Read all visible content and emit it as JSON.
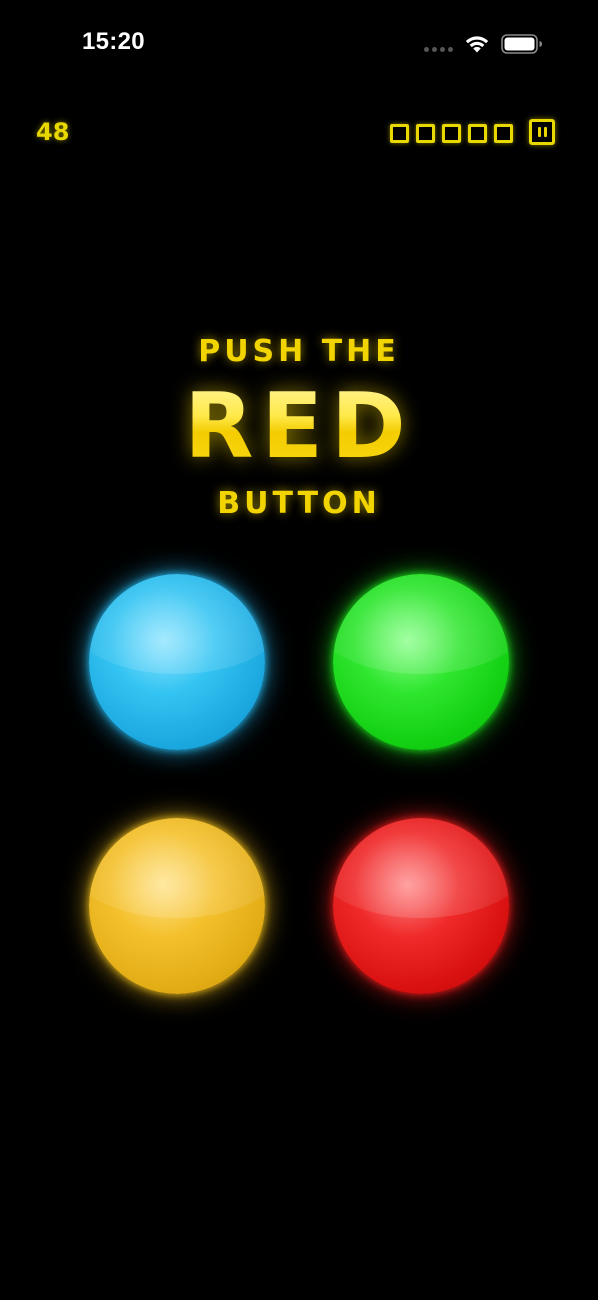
{
  "status_bar": {
    "time": "15:20",
    "icons": [
      "signal-dots-icon",
      "wifi-icon",
      "battery-icon"
    ]
  },
  "hud": {
    "score": "48",
    "lives": {
      "total": 5,
      "color": "#e8d800"
    },
    "pause_icon": "pause-icon"
  },
  "instruction": {
    "line1": "PUSH THE",
    "target": "RED",
    "line3": "BUTTON",
    "color": "#f2d400"
  },
  "buttons": [
    {
      "id": "blue",
      "color": "#1ba8df"
    },
    {
      "id": "green",
      "color": "#12cf12"
    },
    {
      "id": "yellow",
      "color": "#e2ac15"
    },
    {
      "id": "red",
      "color": "#d81010"
    }
  ]
}
